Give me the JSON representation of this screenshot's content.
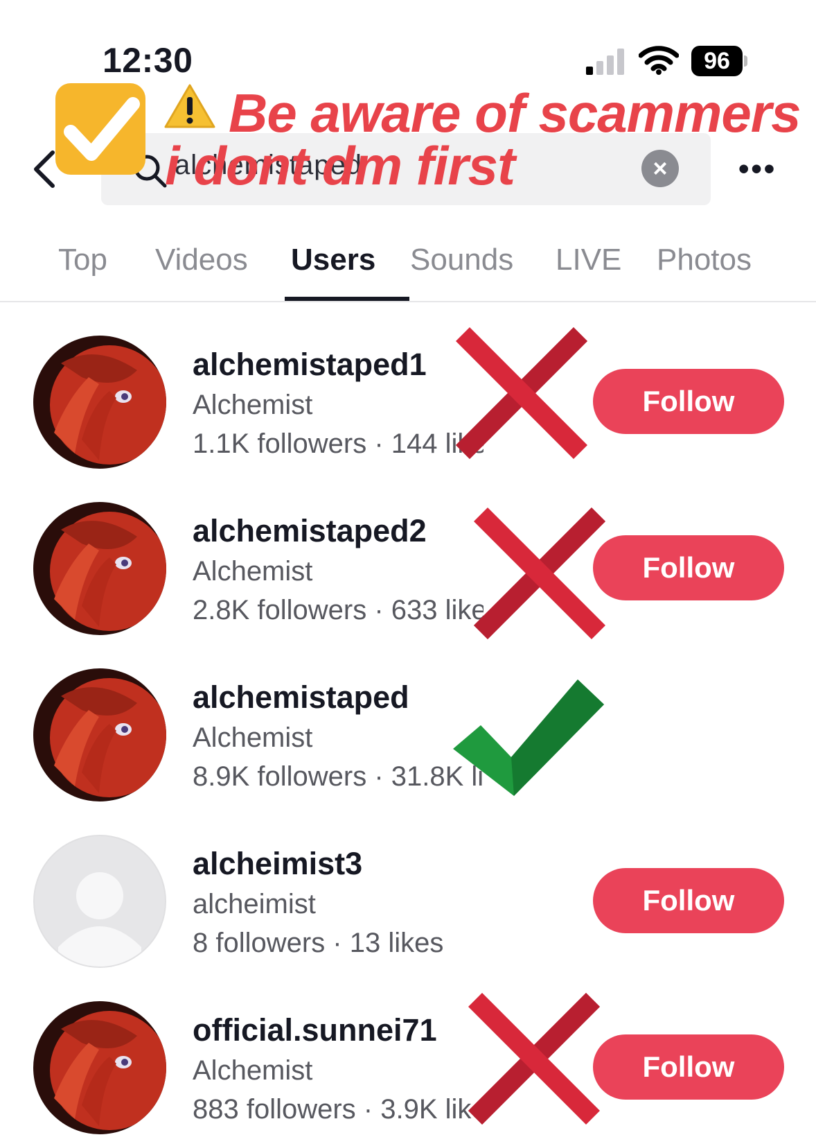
{
  "status_bar": {
    "time": "12:30",
    "battery": "96"
  },
  "search": {
    "query": "alchemistaped"
  },
  "overlay": {
    "line1": "Be aware of scammers",
    "line2": "i dont dm first"
  },
  "tabs": [
    {
      "label": "Top"
    },
    {
      "label": "Videos"
    },
    {
      "label": "Users"
    },
    {
      "label": "Sounds"
    },
    {
      "label": "LIVE"
    },
    {
      "label": "Photos"
    }
  ],
  "active_tab": "Users",
  "users": [
    {
      "username": "alchemistaped1",
      "nickname": "Alchemist",
      "stats": "1.1K followers · 144 likes",
      "follow": "Follow",
      "mark": "red-x"
    },
    {
      "username": "alchemistaped2",
      "nickname": "Alchemist",
      "stats": "2.8K followers · 633 likes",
      "follow": "Follow",
      "mark": "red-x"
    },
    {
      "username": "alchemistaped",
      "nickname": "Alchemist",
      "stats": "8.9K followers · 31.8K likes",
      "follow": "",
      "mark": "green-check"
    },
    {
      "username": "alcheimist3",
      "nickname": "alcheimist",
      "stats": "8 followers · 13 likes",
      "follow": "Follow",
      "mark": "none"
    },
    {
      "username": "official.sunnei71",
      "nickname": "Alchemist",
      "stats": "883 followers · 3.9K likes",
      "follow": "Follow",
      "mark": "red-x"
    }
  ],
  "colors": {
    "accent": "#ea4359",
    "banner_text": "#e8434a",
    "sticker": "#f6b62c",
    "check_green": "#1f9a3e",
    "x_red": "#d8283a"
  }
}
